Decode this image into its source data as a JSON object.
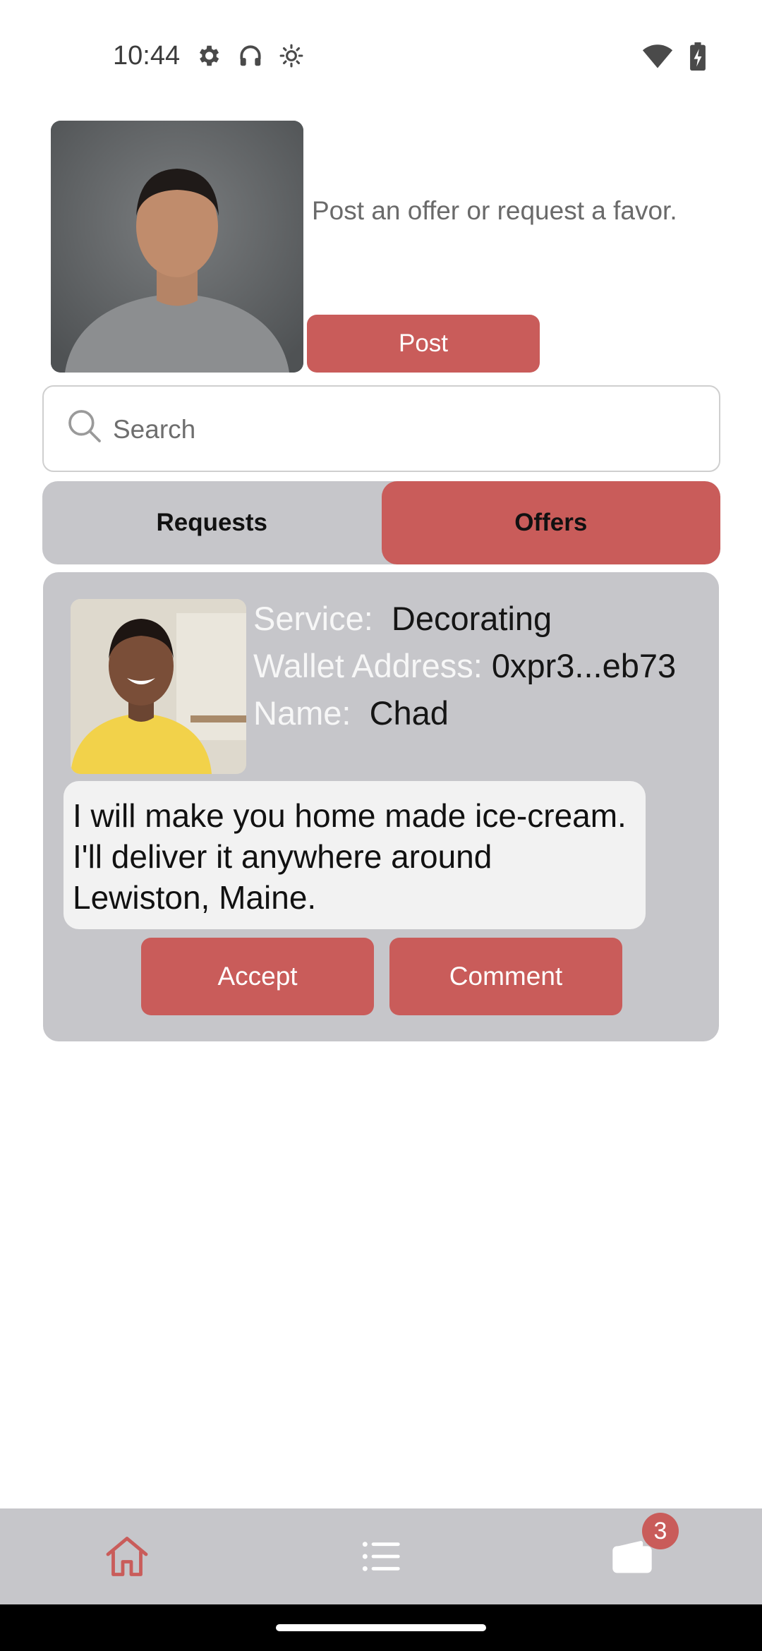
{
  "status_bar": {
    "time": "10:44",
    "left_icons": [
      "gear-icon",
      "headphones-icon",
      "brightness-icon"
    ],
    "right_icons": [
      "wifi-icon",
      "battery-charging-icon"
    ]
  },
  "header": {
    "prompt": "Post an offer or request a favor.",
    "post_label": "Post"
  },
  "search": {
    "placeholder": "Search",
    "value": ""
  },
  "tabs": [
    {
      "label": "Requests",
      "active": false
    },
    {
      "label": "Offers",
      "active": true
    }
  ],
  "offer": {
    "service_label": "Service:",
    "service_value": "Decorating",
    "wallet_label": "Wallet Address:",
    "wallet_value": "0xpr3...eb73",
    "name_label": "Name:",
    "name_value": "Chad",
    "description": "I will make you home made ice-cream. I'll deliver it anywhere around Lewiston, Maine.",
    "accept_label": "Accept",
    "comment_label": "Comment"
  },
  "bottom_nav": {
    "items": [
      "home-icon",
      "list-icon",
      "wallet-icon"
    ],
    "active": "home-icon",
    "wallet_badge": "3"
  },
  "colors": {
    "accent": "#c95c5a",
    "panel": "#c6c6ca",
    "nav_inactive": "#ffffff"
  }
}
